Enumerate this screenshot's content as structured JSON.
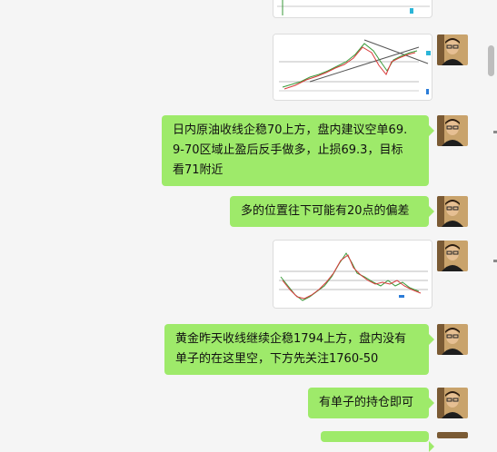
{
  "chat": {
    "messages": [
      {
        "type": "image",
        "alt": "chart-partial"
      },
      {
        "type": "image",
        "alt": "oil-chart"
      },
      {
        "type": "text",
        "lines": [
          "日内原油收线企稳70上方，盘内建议空单69.",
          "9-70区域止盈后反手做多，止损69.3，目标",
          "看71附近"
        ]
      },
      {
        "type": "text",
        "lines": [
          "多的位置往下可能有20点的偏差"
        ]
      },
      {
        "type": "image",
        "alt": "gold-chart"
      },
      {
        "type": "text",
        "lines": [
          "黄金昨天收线继续企稳1794上方，盘内没有",
          "单子的在这里空，下方先关注1760-50"
        ]
      },
      {
        "type": "text",
        "lines": [
          "有单子的持仓即可"
        ]
      }
    ]
  },
  "colors": {
    "bubble": "#9eea6a",
    "background": "#f5f5f5",
    "chart_up": "#3a9a3a",
    "chart_down": "#d83a3a"
  }
}
